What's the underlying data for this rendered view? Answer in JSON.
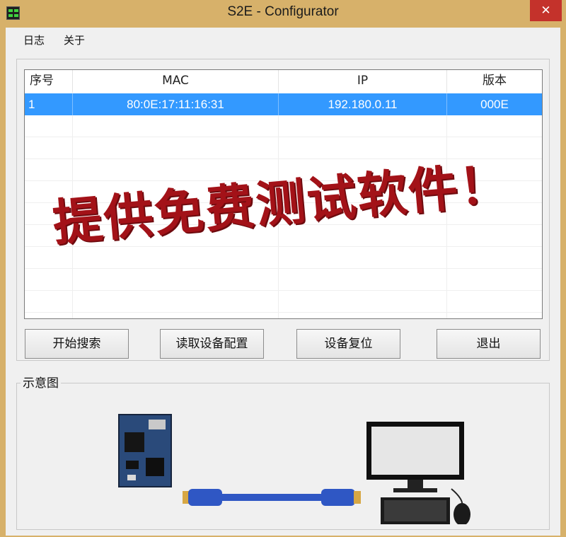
{
  "window": {
    "title": "S2E - Configurator",
    "close_glyph": "✕"
  },
  "menu": {
    "items": [
      "日志",
      "关于"
    ]
  },
  "table": {
    "columns": [
      "序号",
      "MAC",
      "IP",
      "版本"
    ],
    "rows": [
      {
        "index": "1",
        "mac": "80:0E:17:11:16:31",
        "ip": "192.180.0.11",
        "version": "000E"
      }
    ]
  },
  "buttons": {
    "search": "开始搜索",
    "read_config": "读取设备配置",
    "reset": "设备复位",
    "exit": "退出"
  },
  "diagram": {
    "label": "示意图"
  },
  "watermark": {
    "text": "提供免费测试软件！"
  },
  "colors": {
    "title_frame": "#d7b16a",
    "selection": "#3399ff",
    "close": "#c4322b",
    "watermark": "#a31218"
  }
}
